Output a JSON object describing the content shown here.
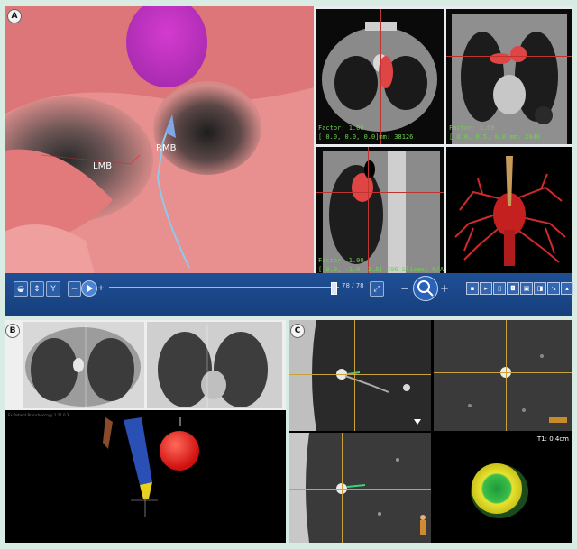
{
  "panels": {
    "a": {
      "label": "A",
      "endoscopy": {
        "lmb_label": "LMB",
        "rmb_label": "RMB"
      },
      "axial": {
        "factor": "Factor: 1.00",
        "coords": "[ 0.0,   0.0,   0.0]mm: 38126"
      },
      "coronal": {
        "factor": "Factor: 1.00",
        "coords": "[ 0.0,   0.5,   0.0]mm: 2846"
      },
      "sagittal": {
        "factor": "Factor: 1.00",
        "coords": "[ 0.0,  -1.0,   3.5] 296 Slices: N/A"
      }
    },
    "b": {
      "label": "B",
      "header_text": "Ex:Patient Bronchoscopy 1.21.0.3"
    },
    "c": {
      "label": "C",
      "measure": "T1: 0.4cm"
    }
  },
  "toolbar": {
    "frame_counter": "78 / 78",
    "minus": "−",
    "plus": "+"
  },
  "colors": {
    "toolbar": "#1a4a8e",
    "tumor": "#e03a3a",
    "overlay_text": "#6dd34a",
    "crosshair": "#c0332e"
  }
}
